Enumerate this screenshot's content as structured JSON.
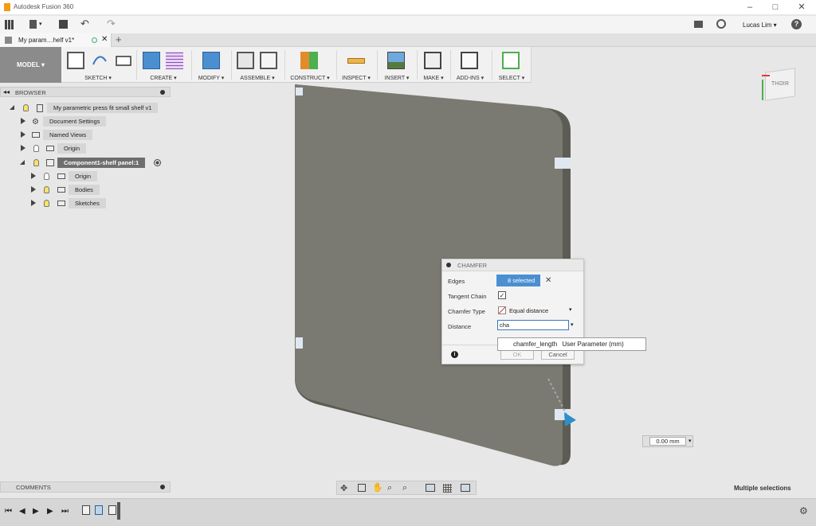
{
  "window": {
    "title": "Autodesk Fusion 360",
    "controls": [
      "–",
      "□",
      "✕"
    ]
  },
  "quickbar": {
    "user": "Lucas Lim ▾",
    "help": "?"
  },
  "tab": {
    "label": "My param…helf v1*"
  },
  "ribbon": {
    "workspace": "MODEL ▾",
    "groups": [
      "SKETCH ▾",
      "CREATE ▾",
      "MODIFY ▾",
      "ASSEMBLE ▾",
      "CONSTRUCT ▾",
      "INSPECT ▾",
      "INSERT ▾",
      "MAKE ▾",
      "ADD-INS ▾",
      "SELECT ▾"
    ]
  },
  "browser": {
    "header": "BROWSER",
    "root": "My parametric press fit small shelf v1",
    "items": [
      "Document Settings",
      "Named Views",
      "Origin",
      "Component1-shelf panel:1"
    ],
    "children": [
      "Origin",
      "Bodies",
      "Sketches"
    ]
  },
  "viewcube": {
    "label": "RIGHT"
  },
  "chamfer": {
    "title": "CHAMFER",
    "edges_label": "Edges",
    "edges_value": "8 selected",
    "tangent_label": "Tangent Chain",
    "type_label": "Chamfer Type",
    "type_value": "Equal distance",
    "distance_label": "Distance",
    "distance_value": "cha",
    "ok": "OK",
    "cancel": "Cancel"
  },
  "suggestion": {
    "name": "chamfer_length",
    "kind": "User Parameter (mm)"
  },
  "measure": {
    "value": "0.00 mm"
  },
  "comments": {
    "label": "COMMENTS"
  },
  "status": {
    "text": "Multiple selections"
  },
  "colors": {
    "panel_face": "#7a7a72",
    "panel_edge": "#5e5e57",
    "selection": "#4a8fd0",
    "accent_orange": "#f39c12"
  }
}
